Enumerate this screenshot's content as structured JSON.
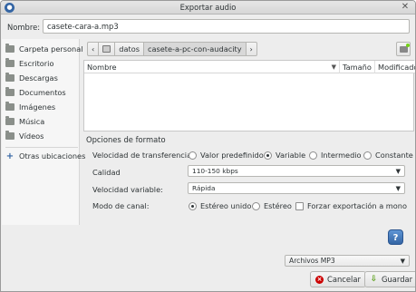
{
  "window": {
    "title": "Exportar audio"
  },
  "name_field": {
    "label": "Nombre:",
    "value": "casete-cara-a.mp3"
  },
  "sidebar": {
    "items": [
      {
        "label": "Carpeta personal",
        "icon": "folder-home-icon"
      },
      {
        "label": "Escritorio",
        "icon": "folder-desktop-icon"
      },
      {
        "label": "Descargas",
        "icon": "folder-download-icon"
      },
      {
        "label": "Documentos",
        "icon": "folder-documents-icon"
      },
      {
        "label": "Imágenes",
        "icon": "folder-pictures-icon"
      },
      {
        "label": "Música",
        "icon": "folder-music-icon"
      },
      {
        "label": "Vídeos",
        "icon": "folder-videos-icon"
      }
    ],
    "other_locations": "Otras ubicaciones"
  },
  "pathbar": {
    "back": "‹",
    "forward": "›",
    "segments": [
      "datos",
      "casete-a-pc-con-audacity"
    ]
  },
  "filelist": {
    "columns": [
      "Nombre",
      "Tamaño",
      "Modificado"
    ]
  },
  "format": {
    "title": "Opciones de formato",
    "bitrate_mode": {
      "label": "Velocidad de transferencia:",
      "options": [
        "Valor predefinido",
        "Variable",
        "Intermedio",
        "Constante"
      ],
      "selected": "Variable"
    },
    "quality": {
      "label": "Calidad",
      "value": "110-150 kbps"
    },
    "variable_speed": {
      "label": "Velocidad variable:",
      "value": "Rápida"
    },
    "channel_mode": {
      "label": "Modo de canal:",
      "options": [
        "Estéreo unido",
        "Estéreo"
      ],
      "selected": "Estéreo unido",
      "force_mono_label": "Forzar exportación a mono",
      "force_mono_checked": false
    }
  },
  "help_button": "?",
  "file_type_filter": "Archivos MP3",
  "buttons": {
    "cancel": "Cancelar",
    "save": "Guardar"
  }
}
